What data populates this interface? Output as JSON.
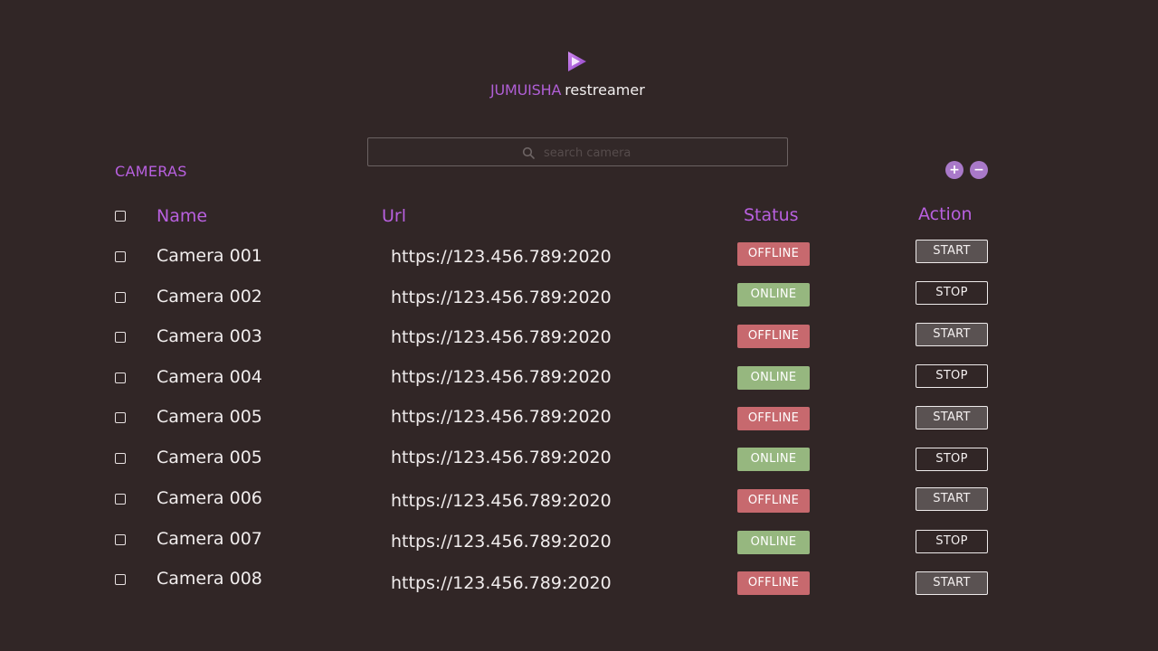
{
  "brand": {
    "name": "JUMUISHA",
    "sub": "restreamer",
    "logo_icon": "play-icon",
    "accent": "#b05fd6"
  },
  "search": {
    "placeholder": "search camera",
    "value": "",
    "icon": "search-icon"
  },
  "section": {
    "title": "CAMERAS"
  },
  "controls": {
    "add_label": "+",
    "remove_label": "−"
  },
  "columns": {
    "name": "Name",
    "url": "Url",
    "status": "Status",
    "action": "Action"
  },
  "colors": {
    "offline": "#c7696e",
    "online": "#96b77f",
    "heading": "#b860df"
  },
  "rows": [
    {
      "name": "Camera 001",
      "url": "https://123.456.789:2020",
      "status": "OFFLINE",
      "action": "START"
    },
    {
      "name": "Camera 002",
      "url": "https://123.456.789:2020",
      "status": "ONLINE",
      "action": "STOP"
    },
    {
      "name": "Camera 003",
      "url": "https://123.456.789:2020",
      "status": "OFFLINE",
      "action": "START"
    },
    {
      "name": "Camera 004",
      "url": "https://123.456.789:2020",
      "status": "ONLINE",
      "action": "STOP"
    },
    {
      "name": "Camera 005",
      "url": "https://123.456.789:2020",
      "status": "OFFLINE",
      "action": "START"
    },
    {
      "name": "Camera 005",
      "url": "https://123.456.789:2020",
      "status": "ONLINE",
      "action": "STOP"
    },
    {
      "name": "Camera 006",
      "url": "https://123.456.789:2020",
      "status": "OFFLINE",
      "action": "START"
    },
    {
      "name": "Camera 007",
      "url": "https://123.456.789:2020",
      "status": "ONLINE",
      "action": "STOP"
    },
    {
      "name": "Camera 008",
      "url": "https://123.456.789:2020",
      "status": "OFFLINE",
      "action": "START"
    }
  ]
}
